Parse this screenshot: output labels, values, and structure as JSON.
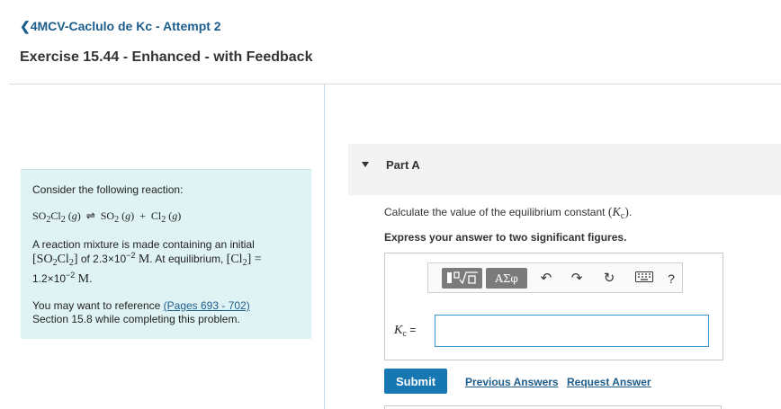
{
  "header": {
    "back_label": "4MCV-Caclulo de Kc - Attempt 2",
    "exercise_title": "Exercise 15.44 - Enhanced - with Feedback"
  },
  "problem": {
    "intro": "Consider the following reaction:",
    "reaction": {
      "reactant": "SO2Cl2",
      "products": [
        "SO2",
        "Cl2"
      ],
      "phase": "g",
      "arrow": "⇌",
      "plus": "+"
    },
    "mixture_line1": "A reaction mixture is made containing an initial",
    "initial_species": "SO2Cl2",
    "initial_prefix": "of 2.3×10",
    "initial_exp": "−2",
    "unit": "M",
    "equilibrium_prefix": ". At equilibrium,",
    "equilibrium_species": "Cl2",
    "equals": "=",
    "equilibrium_value_base": "1.2×10",
    "equilibrium_value_exp": "−2",
    "reference_prefix": "You may want to reference",
    "reference_link": "(Pages 693 - 702)",
    "reference_suffix": "Section 15.8 while completing this problem."
  },
  "part": {
    "label": "Part A",
    "question_prefix": "Calculate the value of the equilibrium constant",
    "instruction": "Express your answer to two significant figures.",
    "kc_label": "K",
    "kc_sub": "c",
    "kc_equals": "=",
    "answer_value": ""
  },
  "toolbar": {
    "templates_icon": "radical-template-icon",
    "greek_label": "ΑΣφ",
    "undo_icon": "undo-icon",
    "redo_icon": "redo-icon",
    "reset_icon": "reset-icon",
    "keyboard_icon": "keyboard-icon",
    "help_label": "?"
  },
  "actions": {
    "submit_label": "Submit",
    "previous_answers_label": "Previous Answers",
    "request_answer_label": "Request Answer"
  },
  "colors": {
    "link": "#1d5d8c",
    "submit": "#1677b3",
    "problem_bg": "#dff3f4",
    "input_border": "#3a97d1"
  }
}
